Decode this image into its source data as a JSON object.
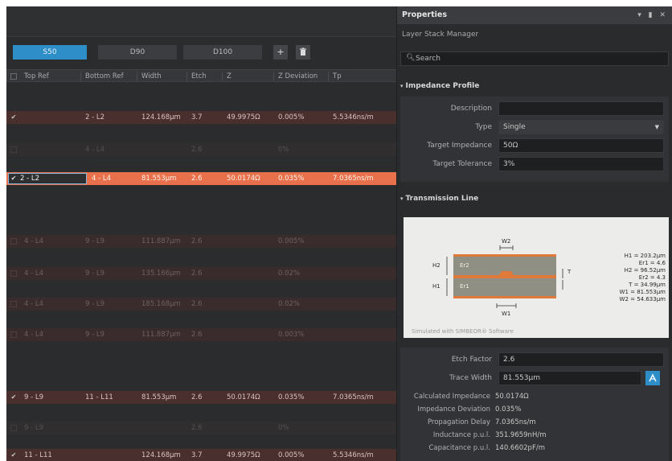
{
  "left": {
    "tabs": [
      "S50",
      "D90",
      "D100"
    ],
    "add_icon": "+",
    "delete_icon": "trash-icon",
    "columns": [
      "Top Ref",
      "Bottom Ref",
      "Width",
      "Etch",
      "Z",
      "Z Deviation",
      "Tp"
    ],
    "rows": [
      {
        "style": "dark",
        "checked": "✔",
        "top": "",
        "bottom": "2 - L2",
        "width": "124.168μm",
        "etch": "3.7",
        "z": "49.9975Ω",
        "zdev": "0.005%",
        "tp": "5.5346ns/m"
      },
      {
        "style": "faint",
        "checked": "",
        "top": "",
        "bottom": "4 - L4",
        "width": "",
        "etch": "2.6",
        "z": "",
        "zdev": "0%",
        "tp": ""
      },
      {
        "style": "sel",
        "checked": "✔",
        "top": "2 - L2",
        "bottom": "4 - L4",
        "width": "81.553μm",
        "etch": "2.6",
        "z": "50.0174Ω",
        "zdev": "0.035%",
        "tp": "7.0365ns/m"
      },
      {
        "style": "dim",
        "checked": "",
        "top": "4 - L4",
        "bottom": "9 - L9",
        "width": "111.887μm",
        "etch": "2.6",
        "z": "",
        "zdev": "0.005%",
        "tp": ""
      },
      {
        "style": "dim",
        "checked": "",
        "top": "4 - L4",
        "bottom": "9 - L9",
        "width": "135.166μm",
        "etch": "2.6",
        "z": "",
        "zdev": "0.02%",
        "tp": ""
      },
      {
        "style": "dim",
        "checked": "",
        "top": "4 - L4",
        "bottom": "9 - L9",
        "width": "185.168μm",
        "etch": "2.6",
        "z": "",
        "zdev": "0.02%",
        "tp": ""
      },
      {
        "style": "dim",
        "checked": "",
        "top": "4 - L4",
        "bottom": "9 - L9",
        "width": "111.887μm",
        "etch": "2.6",
        "z": "",
        "zdev": "0.003%",
        "tp": ""
      },
      {
        "style": "dark",
        "checked": "✔",
        "top": "9 - L9",
        "bottom": "11 - L11",
        "width": "81.553μm",
        "etch": "2.6",
        "z": "50.0174Ω",
        "zdev": "0.035%",
        "tp": "7.0365ns/m"
      },
      {
        "style": "faint",
        "checked": "",
        "top": "9 - L9",
        "bottom": "",
        "width": "",
        "etch": "2.6",
        "z": "",
        "zdev": "0%",
        "tp": ""
      },
      {
        "style": "dark",
        "checked": "✔",
        "top": "11 - L11",
        "bottom": "",
        "width": "124.168μm",
        "etch": "3.7",
        "z": "49.9975Ω",
        "zdev": "0.005%",
        "tp": "5.5346ns/m"
      }
    ]
  },
  "right": {
    "title": "Properties",
    "title_icons": "▾ ▮ ✕",
    "subtitle": "Layer Stack Manager",
    "search_placeholder": "Search",
    "impedance_section": "Impedance Profile",
    "labels": {
      "description": "Description",
      "type": "Type",
      "target_impedance": "Target Impedance",
      "target_tolerance": "Target Tolerance"
    },
    "values": {
      "description": "",
      "type": "Single",
      "target_impedance": "50Ω",
      "target_tolerance": "3%"
    },
    "transmission_section": "Transmission Line",
    "diagram": {
      "w2": "W2",
      "w1": "W1",
      "h2": "H2",
      "h1": "H1",
      "er2": "Er2",
      "er1": "Er1",
      "t": "T",
      "params": [
        "H1 = 203.2μm",
        "Er1 = 4.6",
        "H2 = 96.52μm",
        "Er2 = 4.3",
        "T = 34.99μm",
        "W1 = 81.553μm",
        "W2 = 54.633μm"
      ],
      "credit": "Simulated with SIMBEOR® Software"
    },
    "etch_label": "Etch Factor",
    "etch_value": "2.6",
    "trace_label": "Trace Width",
    "trace_value": "81.553μm",
    "results": [
      {
        "label": "Calculated Impedance",
        "value": "50.0174Ω"
      },
      {
        "label": "Impedance Deviation",
        "value": "0.035%"
      },
      {
        "label": "Propagation Delay",
        "value": "7.0365ns/m"
      },
      {
        "label": "Inductance p.u.l.",
        "value": "351.9659nH/m"
      },
      {
        "label": "Capacitance p.u.l.",
        "value": "140.6602pF/m"
      }
    ]
  }
}
